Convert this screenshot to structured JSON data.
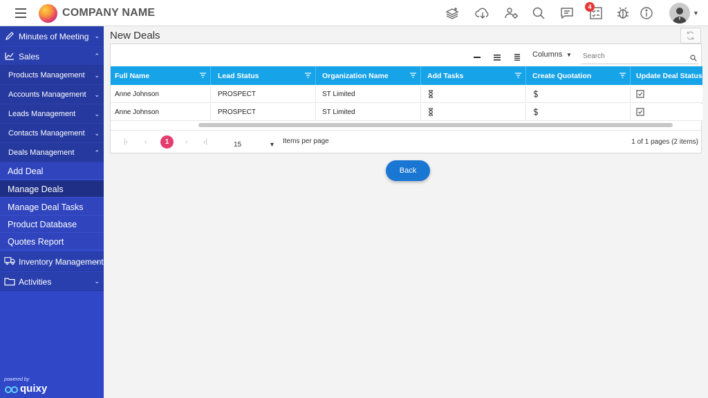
{
  "app": {
    "company_name": "COMPANY NAME",
    "notification_count": "4"
  },
  "header_icons": [
    "add-layers-icon",
    "cloud-download-icon",
    "users-settings-icon",
    "search-icon",
    "chat-icon",
    "tasks-icon",
    "bug-icon",
    "info-icon"
  ],
  "sidebar": {
    "items": [
      {
        "label": "Minutes of Meeting",
        "icon": "pen-icon"
      },
      {
        "label": "Sales",
        "icon": "chart-icon"
      }
    ],
    "sales_sub": [
      {
        "label": "Products Management"
      },
      {
        "label": "Accounts Management"
      },
      {
        "label": "Leads Management"
      },
      {
        "label": "Contacts Management"
      },
      {
        "label": "Deals Management"
      }
    ],
    "deals_leaves": [
      {
        "label": "Add Deal"
      },
      {
        "label": "Manage Deals"
      },
      {
        "label": "Manage Deal Tasks"
      },
      {
        "label": "Product Database"
      },
      {
        "label": "Quotes Report"
      }
    ],
    "bottom_items": [
      {
        "label": "Inventory Management",
        "icon": "truck-icon"
      },
      {
        "label": "Activities",
        "icon": "folder-icon"
      }
    ],
    "powered_by": "powered by",
    "brand": "quixy"
  },
  "page": {
    "title": "New Deals"
  },
  "grid": {
    "columns_label": "Columns",
    "search_placeholder": "Search",
    "headers": [
      "Full Name",
      "Lead Status",
      "Organization Name",
      "Add Tasks",
      "Create Quotation",
      "Update Deal Status"
    ],
    "rows": [
      {
        "full_name": "Anne Johnson",
        "lead_status": "PROSPECT",
        "org": "ST Limited"
      },
      {
        "full_name": "Anne Johnson",
        "lead_status": "PROSPECT",
        "org": "ST Limited"
      }
    ],
    "pager": {
      "current_page": "1",
      "per_page": "15",
      "per_page_label": "Items per page",
      "info": "1 of 1 pages (2 items)"
    }
  },
  "actions": {
    "back": "Back"
  },
  "colors": {
    "accent": "#16a3e8",
    "sidebar": "#3047c8",
    "page_active": "#e33d6e",
    "back_button": "#1976d2",
    "badge": "#e53935"
  }
}
